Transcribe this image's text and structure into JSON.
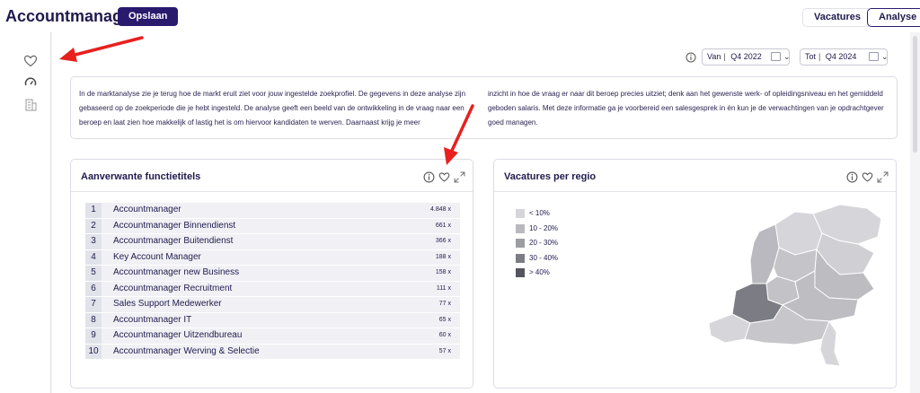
{
  "header": {
    "app_title": "Accountmanager",
    "save_label": "Opslaan",
    "nav": [
      {
        "label": "Vacatures"
      },
      {
        "label": "Analyse"
      }
    ]
  },
  "period": {
    "from_label": "Van",
    "from_value": "Q4 2022",
    "to_label": "Tot",
    "to_value": "Q4 2024"
  },
  "intro": {
    "col1": "In de marktanalyse zie je terug hoe de markt eruit ziet voor jouw ingestelde zoekprofiel. De gegevens in deze analyse zijn gebaseerd op de zoekperiode die je hebt ingesteld. De analyse geeft een beeld van de ontwikkeling in de vraag naar een beroep en laat zien hoe makkelijk of lastig het is om hiervoor kandidaten te werven. Daarnaast krijg je meer",
    "col2": "inzicht in hoe de vraag er naar dit beroep precies uitziet; denk aan het gewenste werk- of opleidingsniveau en het gemiddeld geboden salaris. Met deze informatie ga je voorbereid een salesgesprek in én kun je de verwachtingen van je opdrachtgever goed managen."
  },
  "related_titles": {
    "title": "Aanverwante functietitels",
    "items": [
      {
        "rank": "1",
        "name": "Accountmanager",
        "count": "4.848 x"
      },
      {
        "rank": "2",
        "name": "Accountmanager Binnendienst",
        "count": "661 x"
      },
      {
        "rank": "3",
        "name": "Accountmanager Buitendienst",
        "count": "366 x"
      },
      {
        "rank": "4",
        "name": "Key Account Manager",
        "count": "188 x"
      },
      {
        "rank": "5",
        "name": "Accountmanager new Business",
        "count": "158 x"
      },
      {
        "rank": "6",
        "name": "Accountmanager Recruitment",
        "count": "111 x"
      },
      {
        "rank": "7",
        "name": "Sales Support Medewerker",
        "count": "77 x"
      },
      {
        "rank": "8",
        "name": "Accountmanager IT",
        "count": "65 x"
      },
      {
        "rank": "9",
        "name": "Accountmanager Uitzendbureau",
        "count": "60 x"
      },
      {
        "rank": "10",
        "name": "Accountmanager Werving & Selectie",
        "count": "57 x"
      }
    ]
  },
  "regions": {
    "title": "Vacatures per regio",
    "legend": [
      {
        "label": "< 10%",
        "color": "#d6d6da"
      },
      {
        "label": "10 - 20%",
        "color": "#b9b9bf"
      },
      {
        "label": "20 - 30%",
        "color": "#9c9ca3"
      },
      {
        "label": "30 - 40%",
        "color": "#7c7c84"
      },
      {
        "label": "> 40%",
        "color": "#55555e"
      }
    ]
  },
  "colors": {
    "brand": "#2a1a6e",
    "arrow": "#e8201e"
  },
  "icons": {
    "sidebar": [
      "heart-icon",
      "gauge-icon",
      "building-icon"
    ],
    "card": [
      "info-icon",
      "heart-icon",
      "expand-icon"
    ]
  }
}
